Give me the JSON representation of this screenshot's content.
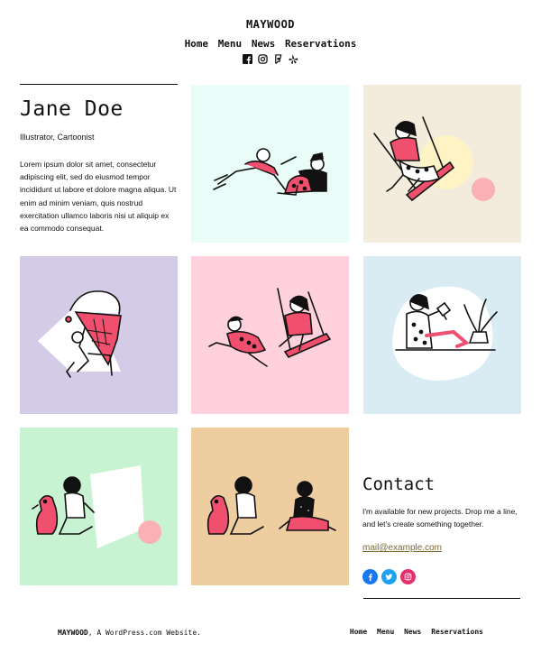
{
  "site": {
    "title": "MAYWOOD"
  },
  "nav": {
    "items": [
      "Home",
      "Menu",
      "News",
      "Reservations"
    ]
  },
  "social_icons": [
    "facebook-icon",
    "instagram-icon",
    "foursquare-icon",
    "yelp-icon"
  ],
  "intro": {
    "name": "Jane Doe",
    "role": "Illustrator, Cartoonist",
    "bio": "Lorem ipsum dolor sit amet, consectetur adipiscing elit, sed do eiusmod tempor incididunt ut labore et dolore magna aliqua. Ut enim ad minim veniam, quis nostrud exercitation ullamco laboris nisi ut aliquip ex ea commodo consequat."
  },
  "gallery": {
    "tile_colors": [
      "#eafcf7",
      "#f3ecdd",
      "#d4cbe6",
      "#ffd1dc",
      "#d9ecf4",
      "#c8f3d3",
      "#eecda0"
    ]
  },
  "contact": {
    "title": "Contact",
    "text": "I'm available for new projects. Drop me a line, and let's create something together.",
    "email": "mail@example.com",
    "social_icons": [
      "facebook-icon",
      "twitter-icon",
      "instagram-icon"
    ],
    "social_colors": [
      "#1877f2",
      "#1da1f2",
      "#e1306c"
    ]
  },
  "footer": {
    "site_name": "MAYWOOD",
    "tagline": ", A WordPress.com Website.",
    "nav": [
      "Home",
      "Menu",
      "News",
      "Reservations"
    ]
  },
  "colors": {
    "accent_pink": "#f0506e",
    "link": "#7a6a2f"
  }
}
